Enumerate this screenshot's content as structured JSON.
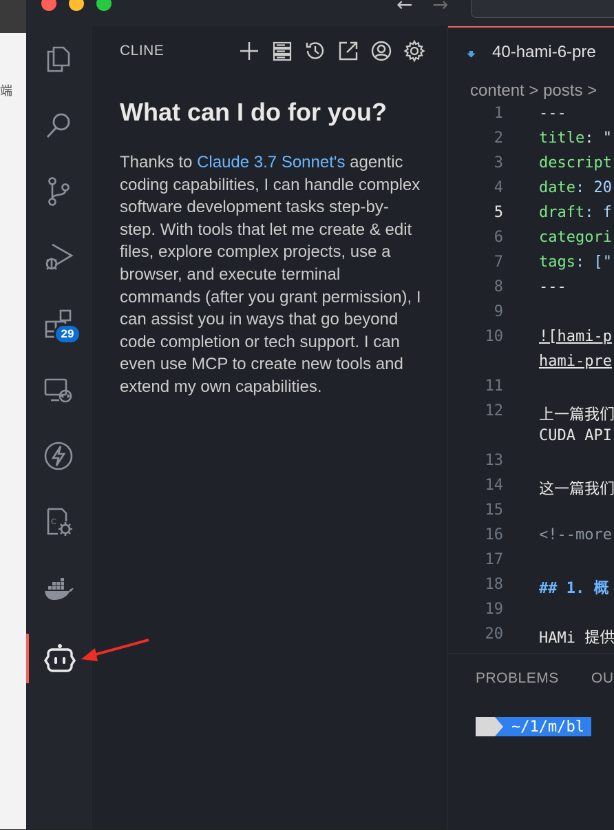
{
  "background_app": {
    "side_glyph": "端"
  },
  "window": {
    "traffic_lights": {
      "close": "#ff5f57",
      "minimize": "#febc2e",
      "zoom": "#28c840"
    },
    "nav": {
      "back": "←",
      "forward": "→"
    }
  },
  "activity_bar": {
    "items": [
      {
        "id": "explorer",
        "icon": "files-icon"
      },
      {
        "id": "search",
        "icon": "search-icon"
      },
      {
        "id": "source-control",
        "icon": "source-control-icon"
      },
      {
        "id": "run-debug",
        "icon": "run-debug-icon"
      },
      {
        "id": "extensions",
        "icon": "extensions-icon",
        "badge": "29"
      },
      {
        "id": "remote-explorer",
        "icon": "remote-explorer-icon"
      },
      {
        "id": "thunder",
        "icon": "lightning-icon"
      },
      {
        "id": "cpp-config",
        "icon": "cpp-gear-icon"
      },
      {
        "id": "docker",
        "icon": "docker-icon"
      },
      {
        "id": "cline",
        "icon": "cline-robot-icon",
        "active": true
      }
    ],
    "active_color": "#f0625a",
    "badge_color": "#0e6ed4"
  },
  "cline_panel": {
    "title": "CLINE",
    "header_icons": [
      "plus-icon",
      "server-icon",
      "history-icon",
      "popout-icon",
      "account-icon",
      "settings-icon"
    ],
    "welcome": {
      "heading": "What can I do for you?",
      "body_prefix": "Thanks to ",
      "model_link": "Claude 3.7 Sonnet's",
      "body_suffix": " agentic coding capabilities, I can handle complex software development tasks step-by-step. With tools that let me create & edit files, explore complex projects, use a browser, and execute terminal commands (after you grant permission), I can assist you in ways that go beyond code completion or tech support. I can even use MCP to create new tools and extend my own capabilities."
    },
    "link_color": "#6cb6ff"
  },
  "editor": {
    "tab": {
      "label": "40-hami-6-pre",
      "icon": "markdown-download-icon"
    },
    "breadcrumb": "content > posts >",
    "current_line": "5",
    "lines": [
      {
        "n": "1",
        "text": "---"
      },
      {
        "n": "2",
        "key": "title",
        "rest": ": \""
      },
      {
        "n": "3",
        "key": "descript",
        "rest": ""
      },
      {
        "n": "4",
        "key": "date",
        "rest": ": 20"
      },
      {
        "n": "5",
        "key": "draft",
        "rest": ": f"
      },
      {
        "n": "6",
        "key": "categori",
        "rest": ""
      },
      {
        "n": "7",
        "key": "tags",
        "rest": ": [\""
      },
      {
        "n": "8",
        "text": "---"
      },
      {
        "n": "9",
        "text": ""
      },
      {
        "n": "10",
        "text": "![hami-p",
        "text2": "hami-pre"
      },
      {
        "n": "11",
        "text": ""
      },
      {
        "n": "12",
        "text": "上一篇我们",
        "text2": "CUDA API"
      },
      {
        "n": "13",
        "text": ""
      },
      {
        "n": "14",
        "text": "这一篇我们"
      },
      {
        "n": "15",
        "text": ""
      },
      {
        "n": "16",
        "text": "<!--more"
      },
      {
        "n": "17",
        "text": ""
      },
      {
        "n": "18",
        "text": "## 1. 概"
      },
      {
        "n": "19",
        "text": ""
      },
      {
        "n": "20",
        "text": "HAMi 提供"
      }
    ]
  },
  "bottom_panel": {
    "tabs": [
      "PROBLEMS",
      "OU"
    ],
    "terminal": {
      "seg1": "",
      "seg2": " ~/1/m/bl"
    }
  }
}
